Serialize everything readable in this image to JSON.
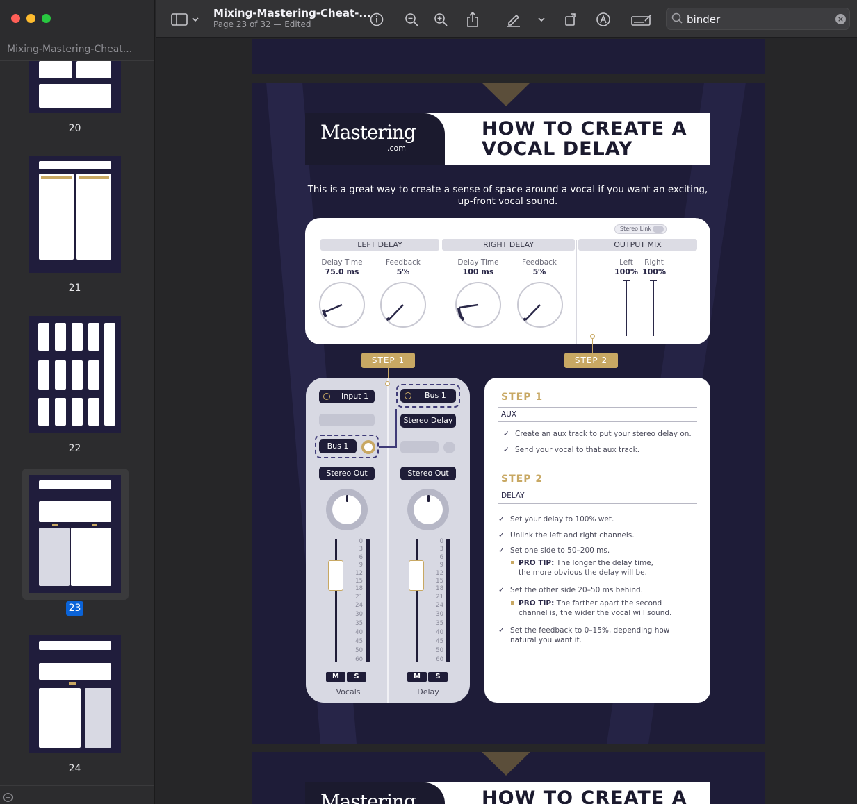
{
  "window": {
    "sidebar_title": "Mixing-Mastering-Cheat...",
    "doc_title": "Mixing-Mastering-Cheat-...",
    "doc_subtitle": "Page 23 of 32 — Edited"
  },
  "toolbar": {
    "icons": [
      "sidebar-toggle-icon",
      "chevron-down-icon",
      "info-icon",
      "zoom-out-icon",
      "zoom-in-icon",
      "share-icon",
      "markup-pen-icon",
      "chevron-down-icon",
      "rotate-icon",
      "annotate-icon",
      "signature-icon"
    ],
    "search_value": "binder"
  },
  "thumbnails": [
    {
      "page": "20"
    },
    {
      "page": "21"
    },
    {
      "page": "22"
    },
    {
      "page": "23",
      "selected": true
    },
    {
      "page": "24"
    }
  ],
  "page": {
    "logo_text": "Mastering",
    "logo_suffix": ".com",
    "title_line1": "HOW TO CREATE A",
    "title_line2": "VOCAL DELAY",
    "intro": "This is a great way to create a sense of space around a vocal if you want an exciting, up-front vocal sound.",
    "plugin": {
      "stereo_link": "Stereo Link",
      "left_delay": {
        "header": "LEFT DELAY",
        "time_label": "Delay Time",
        "time_value": "75.0 ms",
        "fb_label": "Feedback",
        "fb_value": "5%"
      },
      "right_delay": {
        "header": "RIGHT DELAY",
        "time_label": "Delay Time",
        "time_value": "100 ms",
        "fb_label": "Feedback",
        "fb_value": "5%"
      },
      "output_mix": {
        "header": "OUTPUT MIX",
        "left_label": "Left",
        "left_value": "100%",
        "right_label": "Right",
        "right_value": "100%"
      }
    },
    "step1_badge": "STEP 1",
    "step2_badge": "STEP 2",
    "mixer": {
      "vocals": {
        "input": "Input 1",
        "send": "Bus 1",
        "output": "Stereo Out",
        "mute": "M",
        "solo": "S",
        "name": "Vocals"
      },
      "delay": {
        "input": "Bus 1",
        "plugin": "Stereo Delay",
        "output": "Stereo Out",
        "mute": "M",
        "solo": "S",
        "name": "Delay"
      },
      "scale": [
        "0",
        "3",
        "6",
        "9",
        "12",
        "15",
        "18",
        "21",
        "24",
        "30",
        "35",
        "40",
        "45",
        "50",
        "60"
      ]
    },
    "steps": {
      "s1_title": "STEP 1",
      "s1_sub": "AUX",
      "s1_items": [
        "Create an aux track to put your stereo delay on.",
        "Send your vocal to that aux track."
      ],
      "s2_title": "STEP 2",
      "s2_sub": "DELAY",
      "s2_items": [
        "Set your delay to 100% wet.",
        "Unlink the left and right channels.",
        "Set one side to 50–200 ms.",
        "Set the other side 20–50 ms behind.",
        "Set the feedback to 0–15%, depending how natural you want it."
      ],
      "tip1_label": "PRO TIP:",
      "tip1_text_a": "The longer the delay time,",
      "tip1_text_b": "the more obvious the delay will be.",
      "tip2_label": "PRO TIP:",
      "tip2_text_a": "The farther apart the second",
      "tip2_text_b": "channel is, the wider the vocal will sound."
    }
  }
}
